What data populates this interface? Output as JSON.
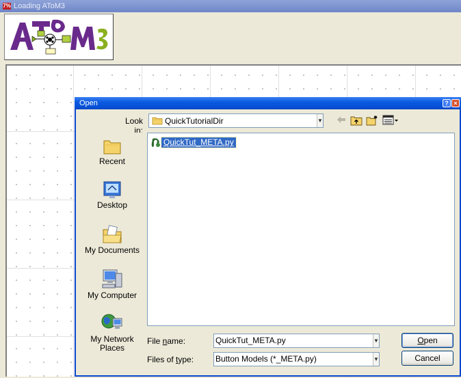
{
  "main_window": {
    "title": "Loading AToM3",
    "logo_text": "AToM3"
  },
  "dialog": {
    "title": "Open",
    "look_in_label": "Look in:",
    "look_in_value": "QuickTutorialDir",
    "places": [
      {
        "label": "Recent",
        "icon": "recent-folder-icon"
      },
      {
        "label": "Desktop",
        "icon": "desktop-icon"
      },
      {
        "label": "My Documents",
        "icon": "my-documents-icon"
      },
      {
        "label": "My Computer",
        "icon": "my-computer-icon"
      },
      {
        "label": "My Network\nPlaces",
        "icon": "network-places-icon"
      }
    ],
    "files": [
      {
        "name": "QuickTut_META.py",
        "icon": "python-file-icon",
        "selected": true
      }
    ],
    "file_name": {
      "label_pre": "File ",
      "label_acc": "n",
      "label_post": "ame:",
      "value": "QuickTut_META.py"
    },
    "file_type": {
      "label_pre": "Files of ",
      "label_acc": "t",
      "label_post": "ype:",
      "value": "Button Models (*_META.py)"
    },
    "open_button": {
      "acc": "O",
      "rest": "pen"
    },
    "cancel_button": "Cancel"
  },
  "colors": {
    "dialog_title": "#0a46d2",
    "selection": "#316ac5",
    "field_border": "#7f9db9"
  }
}
